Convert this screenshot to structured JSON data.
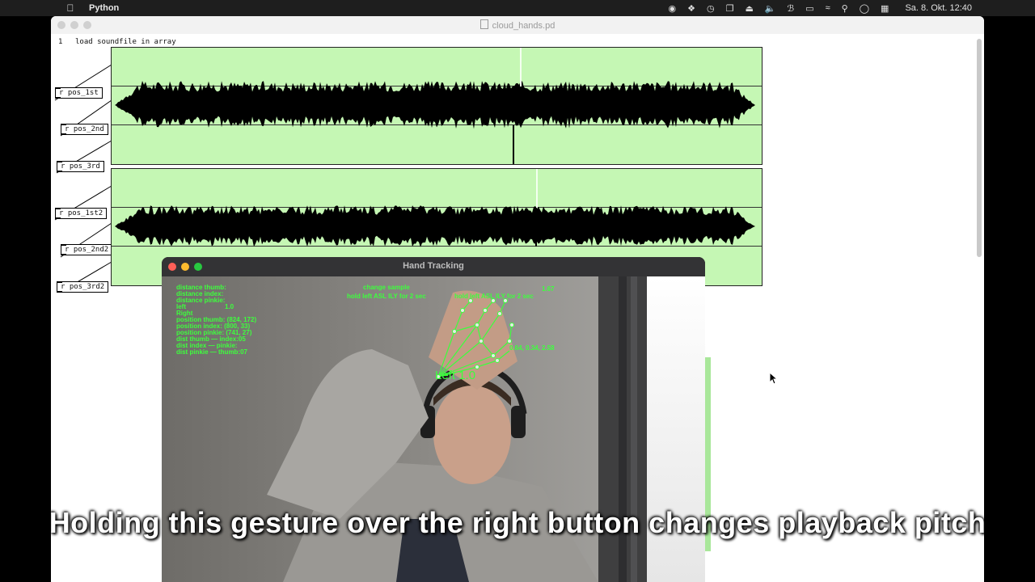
{
  "menubar": {
    "app_name": "Python",
    "datetime": "Sa. 8. Okt.  12:40",
    "tray_icons": [
      "record-icon",
      "dropbox-icon",
      "time-machine-icon",
      "window-icon",
      "eject-icon",
      "volume-icon",
      "bluetooth-icon",
      "battery-icon",
      "wifi-icon",
      "search-icon",
      "user-icon",
      "control-center-icon"
    ]
  },
  "pd_window": {
    "title": "cloud_hands.pd",
    "line_number": "1",
    "comment": "load soundfile in array",
    "array_objects_1": [
      "r pos_1st",
      "r pos_2nd",
      "r pos_3rd"
    ],
    "array_objects_2": [
      "r pos_1st2",
      "r pos_2nd2",
      "r pos_3rd2"
    ],
    "array_color": "#c5f7b4"
  },
  "hand_tracking": {
    "title": "Hand Tracking",
    "overlay_left": [
      "distance thumb:",
      "distance index:",
      "distance pinkie:",
      "left",
      "1.0",
      "Right",
      "position thumb: (824, 172)",
      "position index:  (800, 33)",
      "position pinkie: (741, 27)",
      "dist thumb — index:05",
      "dist index — pinkie:",
      "dist pinkie — thumb:07"
    ],
    "change_sample": "change sample",
    "hold_left": "hold left ASL ILY for 2 sec",
    "hold_right": "hold left ASL ILY for 2 sec",
    "top_right_value": "1.67",
    "coords": "0.64, 0.34, 2.58",
    "hand_label": "Left 1.0",
    "overlay_color": "#3dff3d"
  },
  "caption": "Holding this gesture over the right button changes playback pitch"
}
